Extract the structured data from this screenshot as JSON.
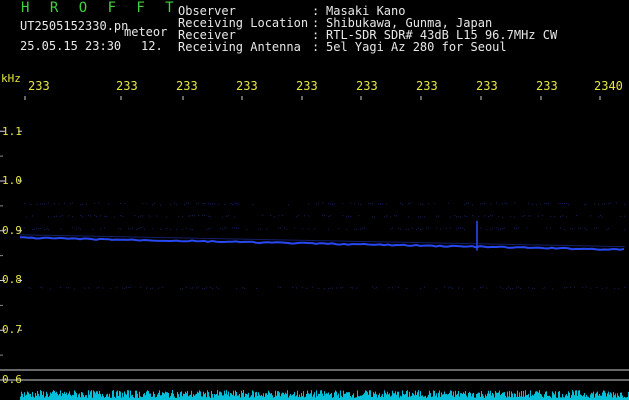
{
  "header": {
    "brand": "H R O F F T",
    "filename": "UT2505152330.pn",
    "record_type": "meteor",
    "timestamp": "25.05.15 23:30",
    "count": "12.",
    "info": [
      {
        "label": "Observer",
        "value": "Masaki Kano"
      },
      {
        "label": "Receiving Location",
        "value": "Shibukawa, Gunma, Japan"
      },
      {
        "label": "Receiver",
        "value": "RTL-SDR SDR# 43dB L15 96.7MHz CW"
      },
      {
        "label": "Receiving Antenna",
        "value": "5el Yagi Az 280 for Seoul"
      }
    ],
    "separator": ":"
  },
  "chart_data": {
    "type": "spectrogram",
    "y_unit": "kHz",
    "y_ticks": [
      "1.1",
      "1.0",
      "0.9",
      "0.8",
      "0.7",
      "0.6"
    ],
    "x_ticks": [
      "233",
      "233",
      "233",
      "233",
      "233",
      "233",
      "233",
      "233",
      "233",
      "2340"
    ],
    "ylim": [
      0.6,
      1.1
    ],
    "carrier_khz_start": 0.886,
    "carrier_khz_end": 0.862,
    "faint_band_khz": 0.786,
    "colors": {
      "signal": "#2a4cff",
      "faint": "#2233aa",
      "baseline": "#00e0ff",
      "grid": "#d0d0d0"
    }
  }
}
